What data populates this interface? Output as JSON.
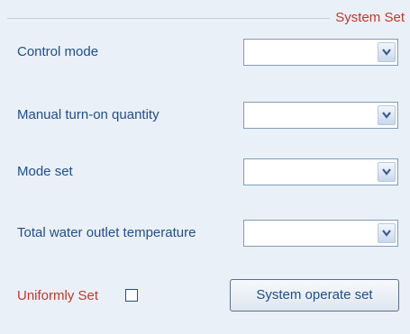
{
  "group": {
    "title": "System Set"
  },
  "rows": [
    {
      "label": "Control mode",
      "value": ""
    },
    {
      "label": "Manual turn-on quantity",
      "value": ""
    },
    {
      "label": "Mode set",
      "value": ""
    },
    {
      "label": "Total water outlet temperature",
      "value": ""
    }
  ],
  "uniform": {
    "label": "Uniformly Set",
    "checked": false
  },
  "operate_button": {
    "label": "System operate set"
  },
  "icons": {
    "dropdown": "chevron-down-icon"
  },
  "colors": {
    "panel_bg": "#eaf0f7",
    "label_text": "#1f4e8c",
    "accent_red": "#c0392b",
    "select_border": "#7f9db9"
  }
}
